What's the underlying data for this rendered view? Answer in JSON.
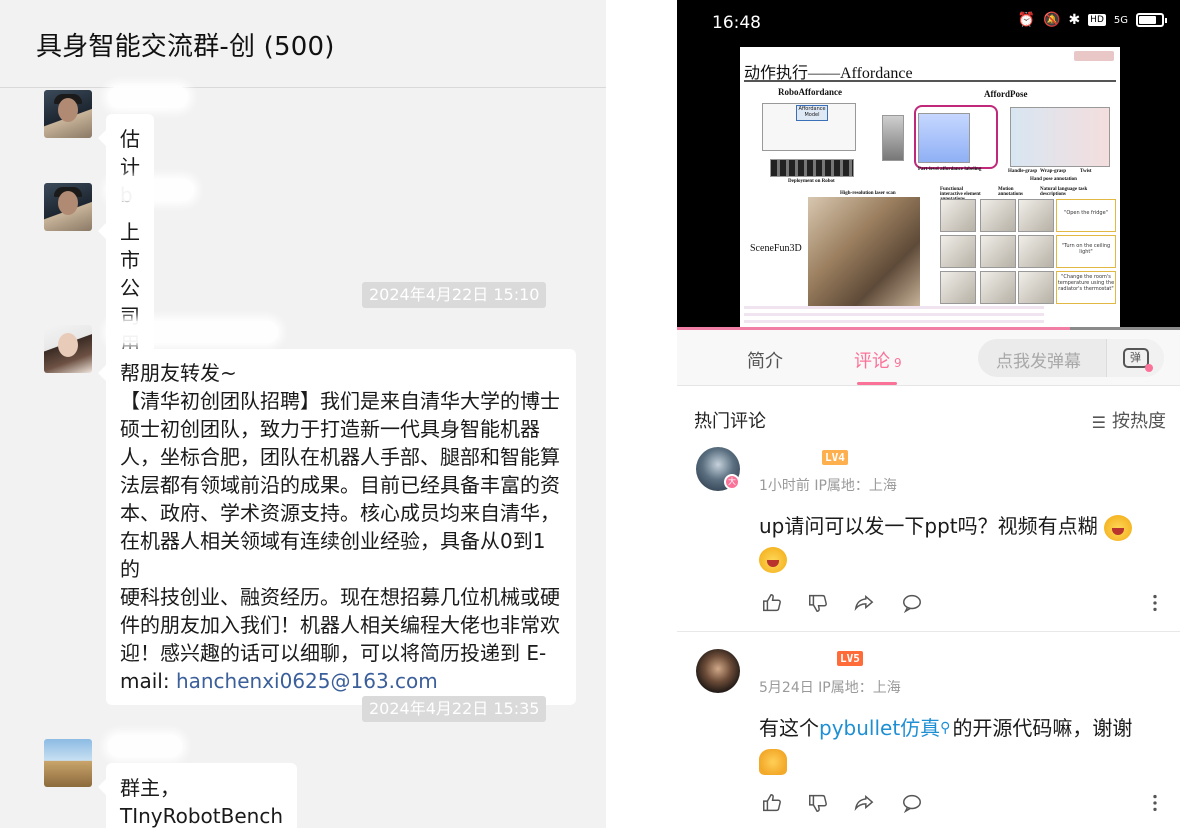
{
  "chat": {
    "title": "具身智能交流群-创 (500)",
    "messages": [
      {
        "text": "估计b轮走不到就倒闭的多过上市的"
      },
      {
        "text": "上市公司用开源另说了"
      },
      {
        "timestamp": "2024年4月22日 15:10"
      },
      {
        "lines": [
          "帮朋友转发~",
          "【清华初创团队招聘】我们是来自清华大学的博士",
          "硕士初创团队，致力于打造新一代具身智能机器",
          "人，坐标合肥，团队在机器人手部、腿部和智能算",
          "法层都有领域前沿的成果。目前已经具备丰富的资",
          "本、政府、学术资源支持。核心成员均来自清华，",
          "在机器人相关领域有连续创业经验，具备从0到1的",
          "硬科技创业、融资经历。现在想招募几位机械或硬",
          "件的朋友加入我们！机器人相关编程大佬也非常欢",
          "迎！感兴趣的话可以细聊，可以将简历投递到 E-"
        ],
        "mail_prefix": "mail: ",
        "email": "hanchenxi0625@163.com"
      },
      {
        "timestamp": "2024年4月22日 15:35"
      },
      {
        "text": "群主，TInyRobotBench开源了吗?"
      }
    ]
  },
  "phone": {
    "status": {
      "time": "16:48",
      "hd": "HD",
      "network": "5G"
    },
    "slide": {
      "title": "动作执行——Affordance",
      "labels": {
        "robo": "RoboAffordance",
        "pose": "AffordPose",
        "scene": "SceneFun3D",
        "deployed": "Deployment on Robot",
        "hires": "High-resolution laser scan",
        "functional": "Functional interactive element annotations",
        "motion": "Motion annotations",
        "natural": "Natural language task descriptions",
        "handle": "Handle-grasp",
        "wrap": "Wrap-grasp",
        "twist": "Twist",
        "hand_pose": "Hand pose annotation",
        "part_level": "Part-level affordance labeling",
        "affordance_model": "Affordance Model",
        "cap1": "\"Open the fridge\"",
        "cap2": "\"Turn on the ceiling light\"",
        "cap3": "\"Change the room's temperature using the radiator's thermostat\""
      }
    },
    "tabs": {
      "intro": "简介",
      "comments": "评论",
      "comment_count": "9"
    },
    "danmaku": {
      "placeholder": "点我发弹幕",
      "button": "弹"
    },
    "hot": {
      "title": "热门评论",
      "sort": "按热度"
    },
    "comments": [
      {
        "level": "LV4",
        "meta": "1小时前  IP属地：上海",
        "text": "up请问可以发一下ppt吗？视频有点糊"
      },
      {
        "level": "LV5",
        "meta": "5月24日  IP属地：上海",
        "text_before": "有这个",
        "link": "pybullet仿真",
        "text_after": "的开源代码嘛，谢谢"
      }
    ]
  },
  "colors": {
    "accent": "#fb7299",
    "link": "#1f8fd4",
    "lv4": "#ffb04e",
    "lv5": "#ff6c3a",
    "email": "#3b5f9a"
  }
}
